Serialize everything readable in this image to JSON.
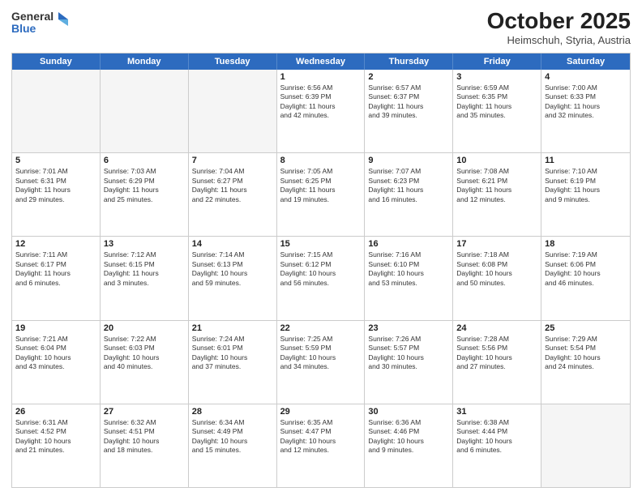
{
  "header": {
    "logo_line1": "General",
    "logo_line2": "Blue",
    "month": "October 2025",
    "location": "Heimschuh, Styria, Austria"
  },
  "days_of_week": [
    "Sunday",
    "Monday",
    "Tuesday",
    "Wednesday",
    "Thursday",
    "Friday",
    "Saturday"
  ],
  "weeks": [
    [
      {
        "day": "",
        "info": ""
      },
      {
        "day": "",
        "info": ""
      },
      {
        "day": "",
        "info": ""
      },
      {
        "day": "1",
        "info": "Sunrise: 6:56 AM\nSunset: 6:39 PM\nDaylight: 11 hours\nand 42 minutes."
      },
      {
        "day": "2",
        "info": "Sunrise: 6:57 AM\nSunset: 6:37 PM\nDaylight: 11 hours\nand 39 minutes."
      },
      {
        "day": "3",
        "info": "Sunrise: 6:59 AM\nSunset: 6:35 PM\nDaylight: 11 hours\nand 35 minutes."
      },
      {
        "day": "4",
        "info": "Sunrise: 7:00 AM\nSunset: 6:33 PM\nDaylight: 11 hours\nand 32 minutes."
      }
    ],
    [
      {
        "day": "5",
        "info": "Sunrise: 7:01 AM\nSunset: 6:31 PM\nDaylight: 11 hours\nand 29 minutes."
      },
      {
        "day": "6",
        "info": "Sunrise: 7:03 AM\nSunset: 6:29 PM\nDaylight: 11 hours\nand 25 minutes."
      },
      {
        "day": "7",
        "info": "Sunrise: 7:04 AM\nSunset: 6:27 PM\nDaylight: 11 hours\nand 22 minutes."
      },
      {
        "day": "8",
        "info": "Sunrise: 7:05 AM\nSunset: 6:25 PM\nDaylight: 11 hours\nand 19 minutes."
      },
      {
        "day": "9",
        "info": "Sunrise: 7:07 AM\nSunset: 6:23 PM\nDaylight: 11 hours\nand 16 minutes."
      },
      {
        "day": "10",
        "info": "Sunrise: 7:08 AM\nSunset: 6:21 PM\nDaylight: 11 hours\nand 12 minutes."
      },
      {
        "day": "11",
        "info": "Sunrise: 7:10 AM\nSunset: 6:19 PM\nDaylight: 11 hours\nand 9 minutes."
      }
    ],
    [
      {
        "day": "12",
        "info": "Sunrise: 7:11 AM\nSunset: 6:17 PM\nDaylight: 11 hours\nand 6 minutes."
      },
      {
        "day": "13",
        "info": "Sunrise: 7:12 AM\nSunset: 6:15 PM\nDaylight: 11 hours\nand 3 minutes."
      },
      {
        "day": "14",
        "info": "Sunrise: 7:14 AM\nSunset: 6:13 PM\nDaylight: 10 hours\nand 59 minutes."
      },
      {
        "day": "15",
        "info": "Sunrise: 7:15 AM\nSunset: 6:12 PM\nDaylight: 10 hours\nand 56 minutes."
      },
      {
        "day": "16",
        "info": "Sunrise: 7:16 AM\nSunset: 6:10 PM\nDaylight: 10 hours\nand 53 minutes."
      },
      {
        "day": "17",
        "info": "Sunrise: 7:18 AM\nSunset: 6:08 PM\nDaylight: 10 hours\nand 50 minutes."
      },
      {
        "day": "18",
        "info": "Sunrise: 7:19 AM\nSunset: 6:06 PM\nDaylight: 10 hours\nand 46 minutes."
      }
    ],
    [
      {
        "day": "19",
        "info": "Sunrise: 7:21 AM\nSunset: 6:04 PM\nDaylight: 10 hours\nand 43 minutes."
      },
      {
        "day": "20",
        "info": "Sunrise: 7:22 AM\nSunset: 6:03 PM\nDaylight: 10 hours\nand 40 minutes."
      },
      {
        "day": "21",
        "info": "Sunrise: 7:24 AM\nSunset: 6:01 PM\nDaylight: 10 hours\nand 37 minutes."
      },
      {
        "day": "22",
        "info": "Sunrise: 7:25 AM\nSunset: 5:59 PM\nDaylight: 10 hours\nand 34 minutes."
      },
      {
        "day": "23",
        "info": "Sunrise: 7:26 AM\nSunset: 5:57 PM\nDaylight: 10 hours\nand 30 minutes."
      },
      {
        "day": "24",
        "info": "Sunrise: 7:28 AM\nSunset: 5:56 PM\nDaylight: 10 hours\nand 27 minutes."
      },
      {
        "day": "25",
        "info": "Sunrise: 7:29 AM\nSunset: 5:54 PM\nDaylight: 10 hours\nand 24 minutes."
      }
    ],
    [
      {
        "day": "26",
        "info": "Sunrise: 6:31 AM\nSunset: 4:52 PM\nDaylight: 10 hours\nand 21 minutes."
      },
      {
        "day": "27",
        "info": "Sunrise: 6:32 AM\nSunset: 4:51 PM\nDaylight: 10 hours\nand 18 minutes."
      },
      {
        "day": "28",
        "info": "Sunrise: 6:34 AM\nSunset: 4:49 PM\nDaylight: 10 hours\nand 15 minutes."
      },
      {
        "day": "29",
        "info": "Sunrise: 6:35 AM\nSunset: 4:47 PM\nDaylight: 10 hours\nand 12 minutes."
      },
      {
        "day": "30",
        "info": "Sunrise: 6:36 AM\nSunset: 4:46 PM\nDaylight: 10 hours\nand 9 minutes."
      },
      {
        "day": "31",
        "info": "Sunrise: 6:38 AM\nSunset: 4:44 PM\nDaylight: 10 hours\nand 6 minutes."
      },
      {
        "day": "",
        "info": ""
      }
    ]
  ]
}
